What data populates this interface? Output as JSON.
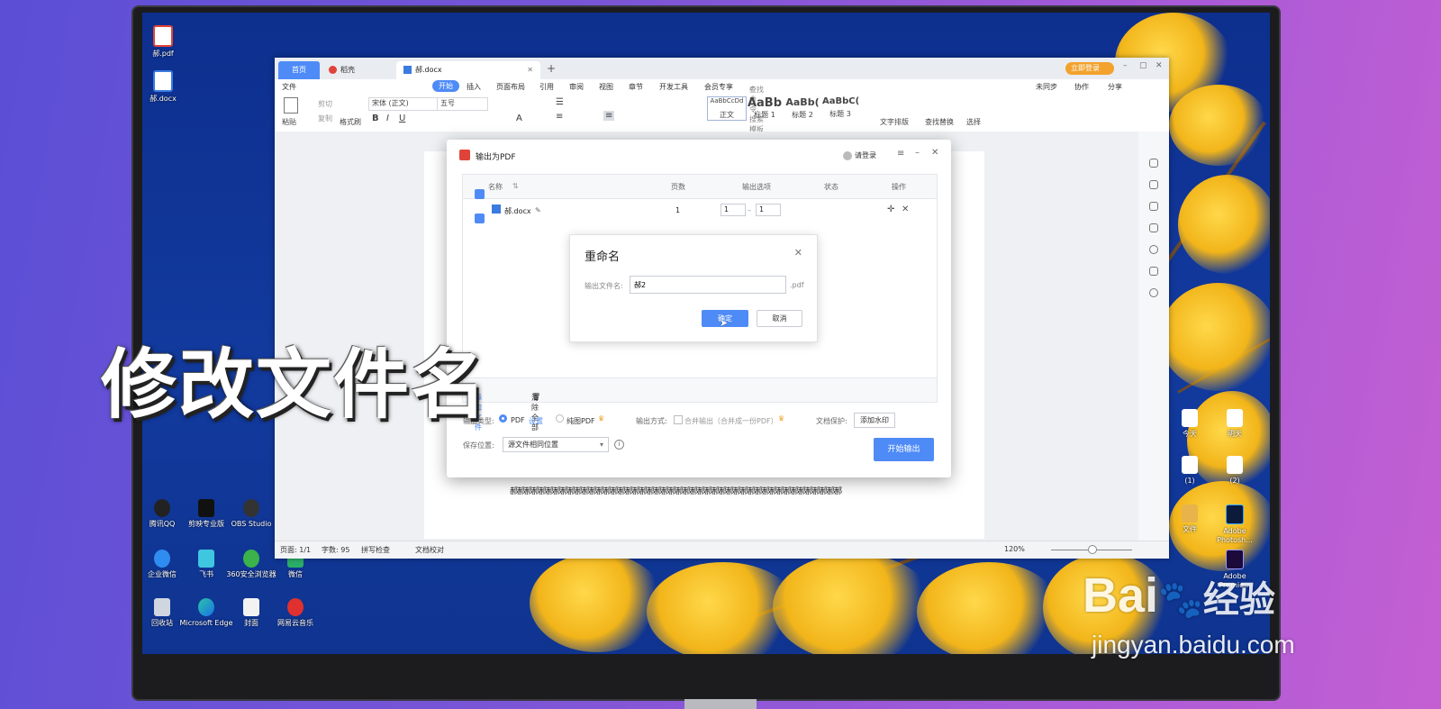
{
  "overlay_title": "修改文件名",
  "watermark": {
    "brand": "Bai",
    "brand_cn": "经验",
    "url": "jingyan.baidu.com"
  },
  "desktop_icons_left": [
    {
      "label": "腾讯QQ",
      "icon": "qq-icon"
    },
    {
      "label": "剪映专业版",
      "icon": "capcut-icon"
    },
    {
      "label": "OBS Studio",
      "icon": "obs-icon"
    },
    {
      "label": "企业微信",
      "icon": "wecom-icon"
    },
    {
      "label": "飞书",
      "icon": "feishu-icon"
    },
    {
      "label": "360安全浏览器",
      "icon": "360-browser-icon"
    },
    {
      "label": "微信",
      "icon": "wechat-icon"
    },
    {
      "label": "回收站",
      "icon": "recycle-bin-icon"
    },
    {
      "label": "Microsoft Edge",
      "icon": "edge-icon"
    },
    {
      "label": "封面",
      "icon": "image-file-icon"
    },
    {
      "label": "网易云音乐",
      "icon": "netease-music-icon"
    }
  ],
  "desktop_icons_top": [
    {
      "label": "郝.pdf",
      "icon": "pdf-file-icon"
    },
    {
      "label": "郝.docx",
      "icon": "docx-file-icon"
    }
  ],
  "desktop_icons_right": [
    {
      "label": "今天"
    },
    {
      "label": "明天"
    },
    {
      "label": "(1)"
    },
    {
      "label": "(2)"
    },
    {
      "label": "文件"
    },
    {
      "label": "Adobe Photosh..."
    },
    {
      "label": "Adobe Premie..."
    }
  ],
  "wps": {
    "tabs": {
      "home": "首页",
      "shell": "稻壳",
      "doc": "郝.docx"
    },
    "titlebar_right": {
      "login": "立即登录"
    },
    "menu": [
      "文件",
      "开始",
      "插入",
      "页面布局",
      "引用",
      "审阅",
      "视图",
      "章节",
      "开发工具",
      "会员专享"
    ],
    "search_placeholder": "查找命令、搜索模板",
    "menu_right": {
      "sync": "未同步",
      "collab": "协作",
      "share": "分享"
    },
    "ribbon": {
      "paste": "粘贴",
      "cut": "剪切",
      "copy": "复制",
      "format_painter": "格式刷",
      "font_name": "宋体 (正文)",
      "font_size": "五号",
      "styles": [
        {
          "sample": "AaBbCcDd",
          "label": "正文"
        },
        {
          "sample": "AaBb",
          "label": "标题 1"
        },
        {
          "sample": "AaBb(",
          "label": "标题 2"
        },
        {
          "sample": "AaBbC(",
          "label": "标题 3"
        }
      ],
      "text_layout": "文字排版",
      "find_replace": "查找替换",
      "select": "选择"
    },
    "statusbar": {
      "page": "页面: 1/1",
      "words": "字数: 95",
      "spellcheck": "拼写检查",
      "proof": "文档校对",
      "zoom": "120%"
    },
    "doc_text": "郝郝郝郝郝郝郝郝郝郝郝郝郝郝郝郝郝郝郝郝郝郝郝郝郝郝郝郝郝郝郝郝郝郝郝郝郝郝郝郝郝郝郝郝郝郝"
  },
  "pdf_dialog": {
    "title": "输出为PDF",
    "login": "请登录",
    "columns": {
      "name": "名称",
      "pages": "页数",
      "options": "输出选项",
      "status": "状态",
      "ops": "操作"
    },
    "row": {
      "name": "郝.docx",
      "pages": "1",
      "from": "1",
      "to": "1"
    },
    "add_file": "添加文件",
    "clear_all": "清除全部",
    "type_label": "输出类型:",
    "type_pdf": "PDF",
    "type_settings": "设置",
    "type_image_pdf": "纯图PDF",
    "method_label": "输出方式:",
    "method_merge": "合并输出（合并成一份PDF）",
    "protect_label": "文档保护:",
    "watermark_btn": "添加水印",
    "save_label": "保存位置:",
    "save_value": "源文件相同位置",
    "start_btn": "开始输出"
  },
  "rename_dialog": {
    "title": "重命名",
    "field_label": "输出文件名:",
    "field_value": "郝2",
    "suffix": ".pdf",
    "ok": "确定",
    "cancel": "取消"
  }
}
